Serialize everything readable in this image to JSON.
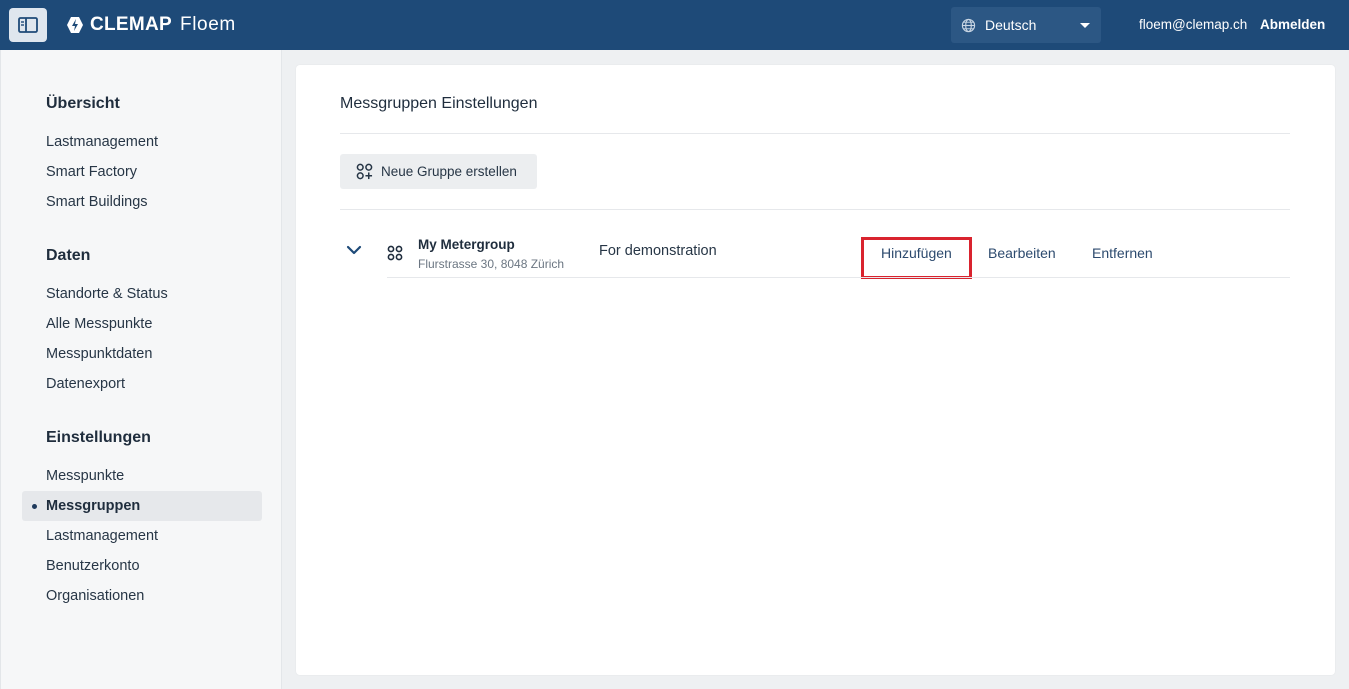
{
  "header": {
    "brand": "CLEMAP",
    "product": "Floem",
    "language": "Deutsch",
    "user_email": "floem@clemap.ch",
    "logout_label": "Abmelden"
  },
  "sidebar": {
    "sections": [
      {
        "title": "Übersicht",
        "items": [
          "Lastmanagement",
          "Smart Factory",
          "Smart Buildings"
        ]
      },
      {
        "title": "Daten",
        "items": [
          "Standorte & Status",
          "Alle Messpunkte",
          "Messpunktdaten",
          "Datenexport"
        ]
      },
      {
        "title": "Einstellungen",
        "items": [
          "Messpunkte",
          "Messgruppen",
          "Lastmanagement",
          "Benutzerkonto",
          "Organisationen"
        ]
      }
    ],
    "active_item": "Messgruppen"
  },
  "main": {
    "title": "Messgruppen Einstellungen",
    "new_group_label": "Neue Gruppe erstellen",
    "groups": [
      {
        "name": "My Metergroup",
        "address": "Flurstrasse 30, 8048 Zürich",
        "description": "For demonstration",
        "actions": [
          "Hinzufügen",
          "Bearbeiten",
          "Entfernen"
        ]
      }
    ]
  },
  "colors": {
    "header_bg": "#1e4a78",
    "highlight": "#d9232e"
  }
}
